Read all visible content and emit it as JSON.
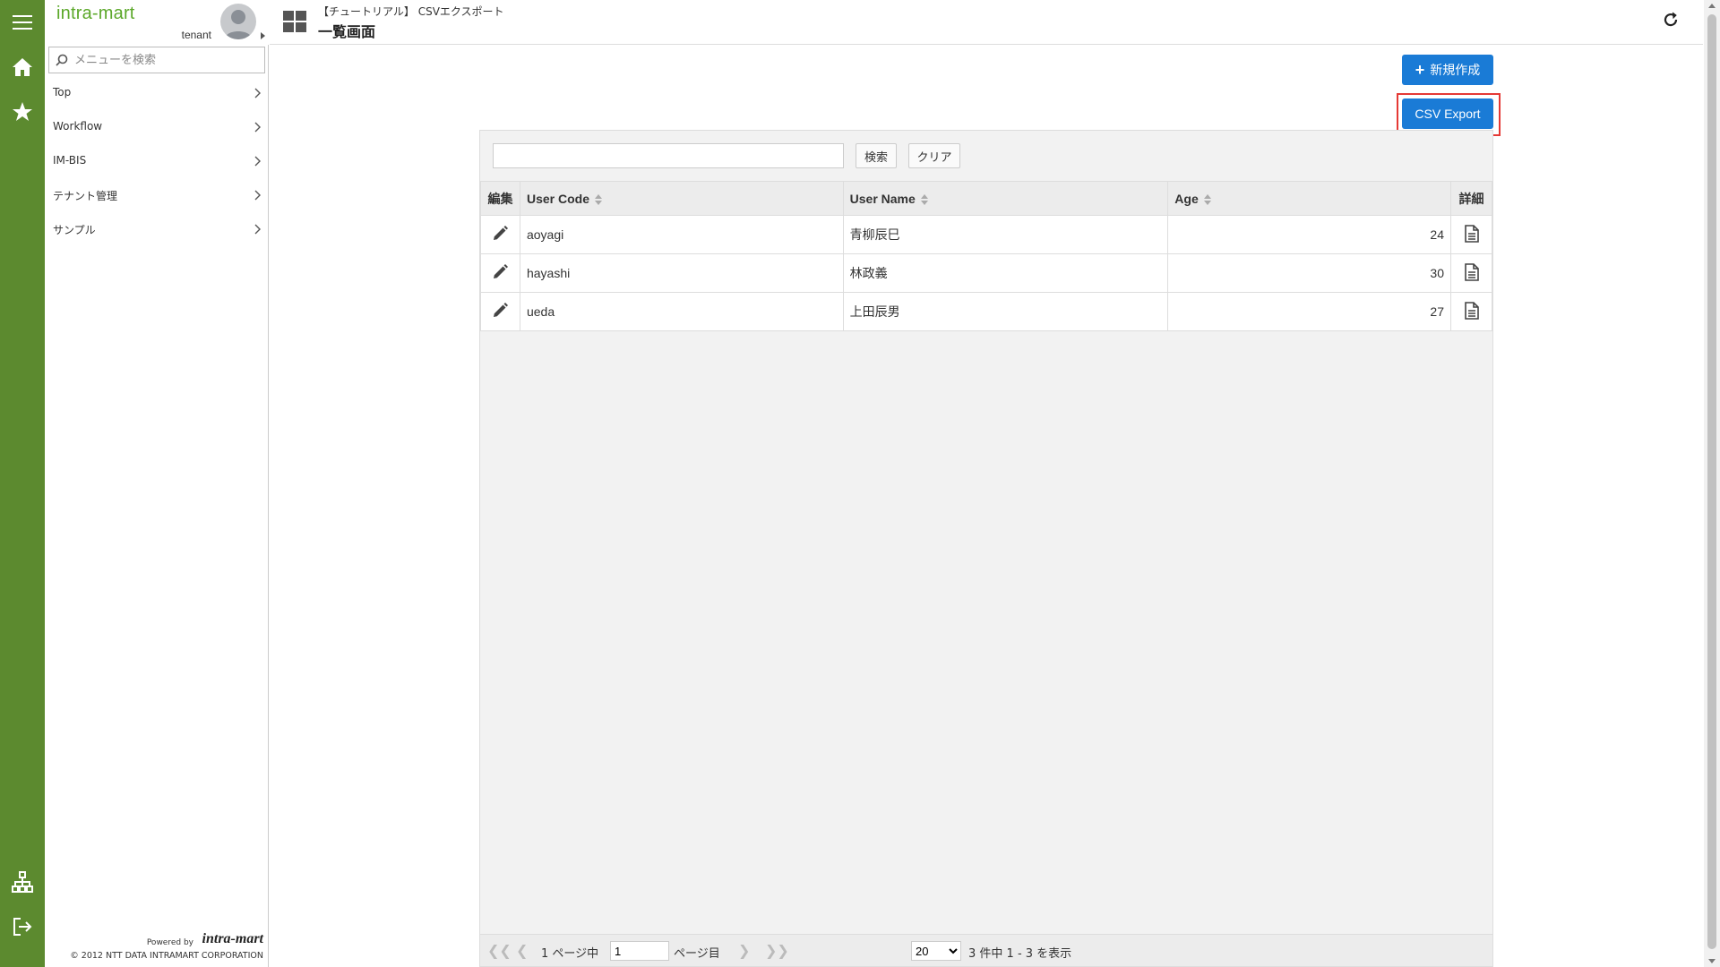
{
  "app": {
    "brand": "intra-mart",
    "tenant": "tenant"
  },
  "sidebar": {
    "search_placeholder": "メニューを検索",
    "items": [
      {
        "label": "Top"
      },
      {
        "label": "Workflow"
      },
      {
        "label": "IM-BIS"
      },
      {
        "label": "テナント管理"
      },
      {
        "label": "サンプル"
      }
    ],
    "powered_by": "Powered by",
    "logo_text": "intra-mart",
    "copyright": "© 2012 NTT DATA INTRAMART CORPORATION"
  },
  "header": {
    "breadcrumb": "【チュートリアル】 CSVエクスポート",
    "title": "一覧画面"
  },
  "actions": {
    "new_label": "新規作成",
    "csv_export_label": "CSV Export"
  },
  "search": {
    "value": "",
    "search_label": "検索",
    "clear_label": "クリア"
  },
  "table": {
    "columns": [
      "編集",
      "User Code",
      "User Name",
      "Age",
      "詳細"
    ],
    "rows": [
      {
        "user_code": "aoyagi",
        "user_name": "青柳辰巳",
        "age": "24"
      },
      {
        "user_code": "hayashi",
        "user_name": "林政義",
        "age": "30"
      },
      {
        "user_code": "ueda",
        "user_name": "上田辰男",
        "age": "27"
      }
    ]
  },
  "pager": {
    "of_pages": "1 ページ中",
    "current_page": "1",
    "page_suffix": "ページ目",
    "page_size": "20",
    "page_size_options": [
      "20"
    ],
    "summary": "3 件中 1 - 3 を表示"
  },
  "colors": {
    "rail": "#5c8a2f",
    "brand": "#5ca82a",
    "primary": "#1a7bd6",
    "highlight": "#e53935"
  }
}
